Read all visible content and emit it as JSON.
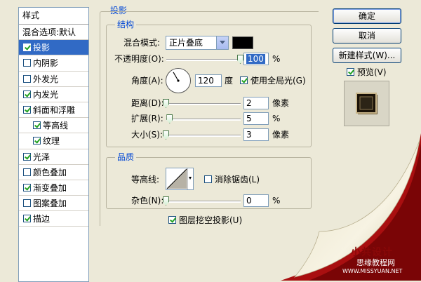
{
  "style_list": {
    "header": "样式",
    "items": [
      {
        "label": "混合选项:默认",
        "checkbox": false,
        "checked": false,
        "selected": false,
        "indent": false
      },
      {
        "label": "投影",
        "checkbox": true,
        "checked": true,
        "selected": true,
        "indent": false
      },
      {
        "label": "内阴影",
        "checkbox": true,
        "checked": false,
        "selected": false,
        "indent": false
      },
      {
        "label": "外发光",
        "checkbox": true,
        "checked": false,
        "selected": false,
        "indent": false
      },
      {
        "label": "内发光",
        "checkbox": true,
        "checked": true,
        "selected": false,
        "indent": false
      },
      {
        "label": "斜面和浮雕",
        "checkbox": true,
        "checked": true,
        "selected": false,
        "indent": false
      },
      {
        "label": "等高线",
        "checkbox": true,
        "checked": true,
        "selected": false,
        "indent": true
      },
      {
        "label": "纹理",
        "checkbox": true,
        "checked": true,
        "selected": false,
        "indent": true
      },
      {
        "label": "光泽",
        "checkbox": true,
        "checked": true,
        "selected": false,
        "indent": false
      },
      {
        "label": "颜色叠加",
        "checkbox": true,
        "checked": false,
        "selected": false,
        "indent": false
      },
      {
        "label": "渐变叠加",
        "checkbox": true,
        "checked": true,
        "selected": false,
        "indent": false
      },
      {
        "label": "图案叠加",
        "checkbox": true,
        "checked": false,
        "selected": false,
        "indent": false
      },
      {
        "label": "描边",
        "checkbox": true,
        "checked": true,
        "selected": false,
        "indent": false
      }
    ]
  },
  "drop_shadow": {
    "title": "投影",
    "structure": {
      "title": "结构",
      "blend_mode_label": "混合模式:",
      "blend_mode_value": "正片叠底",
      "shadow_color": "#000000",
      "opacity_label": "不透明度(O):",
      "opacity_value": "100",
      "opacity_unit": "%",
      "opacity_fraction": 1.0,
      "angle_label": "角度(A):",
      "angle_value": "120",
      "angle_unit": "度",
      "global_light_label": "使用全局光(G)",
      "global_light_checked": true,
      "distance_label": "距离(D):",
      "distance_value": "2",
      "distance_unit": "像素",
      "distance_fraction": 0.0,
      "spread_label": "扩展(R):",
      "spread_value": "5",
      "spread_unit": "%",
      "spread_fraction": 0.05,
      "size_label": "大小(S):",
      "size_value": "3",
      "size_unit": "像素",
      "size_fraction": 0.0
    },
    "quality": {
      "title": "品质",
      "contour_label": "等高线:",
      "antialias_label": "消除锯齿(L)",
      "antialias_checked": false,
      "noise_label": "杂色(N):",
      "noise_value": "0",
      "noise_unit": "%",
      "noise_fraction": 0.0
    },
    "knockout_label": "图层挖空投影(U)",
    "knockout_checked": true
  },
  "buttons": {
    "ok": "确定",
    "cancel": "取消",
    "new_style": "新建样式(W)..."
  },
  "preview": {
    "label": "预览(V)",
    "checked": true
  },
  "watermark": {
    "logo": "小共设计",
    "line1": "思缘教程网",
    "line2": "WWW.MISSYUAN.NET"
  }
}
